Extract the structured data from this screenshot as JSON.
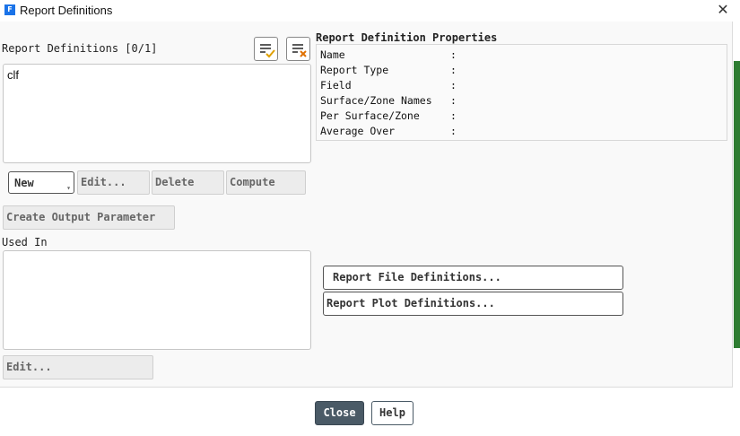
{
  "window": {
    "title": "Report Definitions",
    "icon_letter": "F"
  },
  "left": {
    "list_label": "Report Definitions [0/1]",
    "list_items": [
      "clf"
    ],
    "buttons": {
      "new": "New",
      "edit": "Edit...",
      "delete": "Delete",
      "compute": "Compute"
    },
    "create_output_parameter": "Create Output Parameter",
    "used_in_label": "Used In",
    "used_in_edit": "Edit..."
  },
  "properties": {
    "title": "Report Definition Properties",
    "rows": [
      {
        "key": "Name",
        "sep": ":"
      },
      {
        "key": "Report Type",
        "sep": ":"
      },
      {
        "key": "Field",
        "sep": ":"
      },
      {
        "key": "Surface/Zone Names",
        "sep": ":"
      },
      {
        "key": "Per Surface/Zone",
        "sep": ":"
      },
      {
        "key": "Average Over",
        "sep": ":"
      }
    ]
  },
  "right_buttons": {
    "file_defs": "Report File Definitions...",
    "plot_defs": "Report Plot Definitions..."
  },
  "footer": {
    "close": "Close",
    "help": "Help"
  },
  "colors": {
    "app_icon": "#1a73e8",
    "close_button": "#4a5a66",
    "scroll_accent": "#2e7d32",
    "check_icon": "#e0a000",
    "x_icon": "#e07000"
  }
}
